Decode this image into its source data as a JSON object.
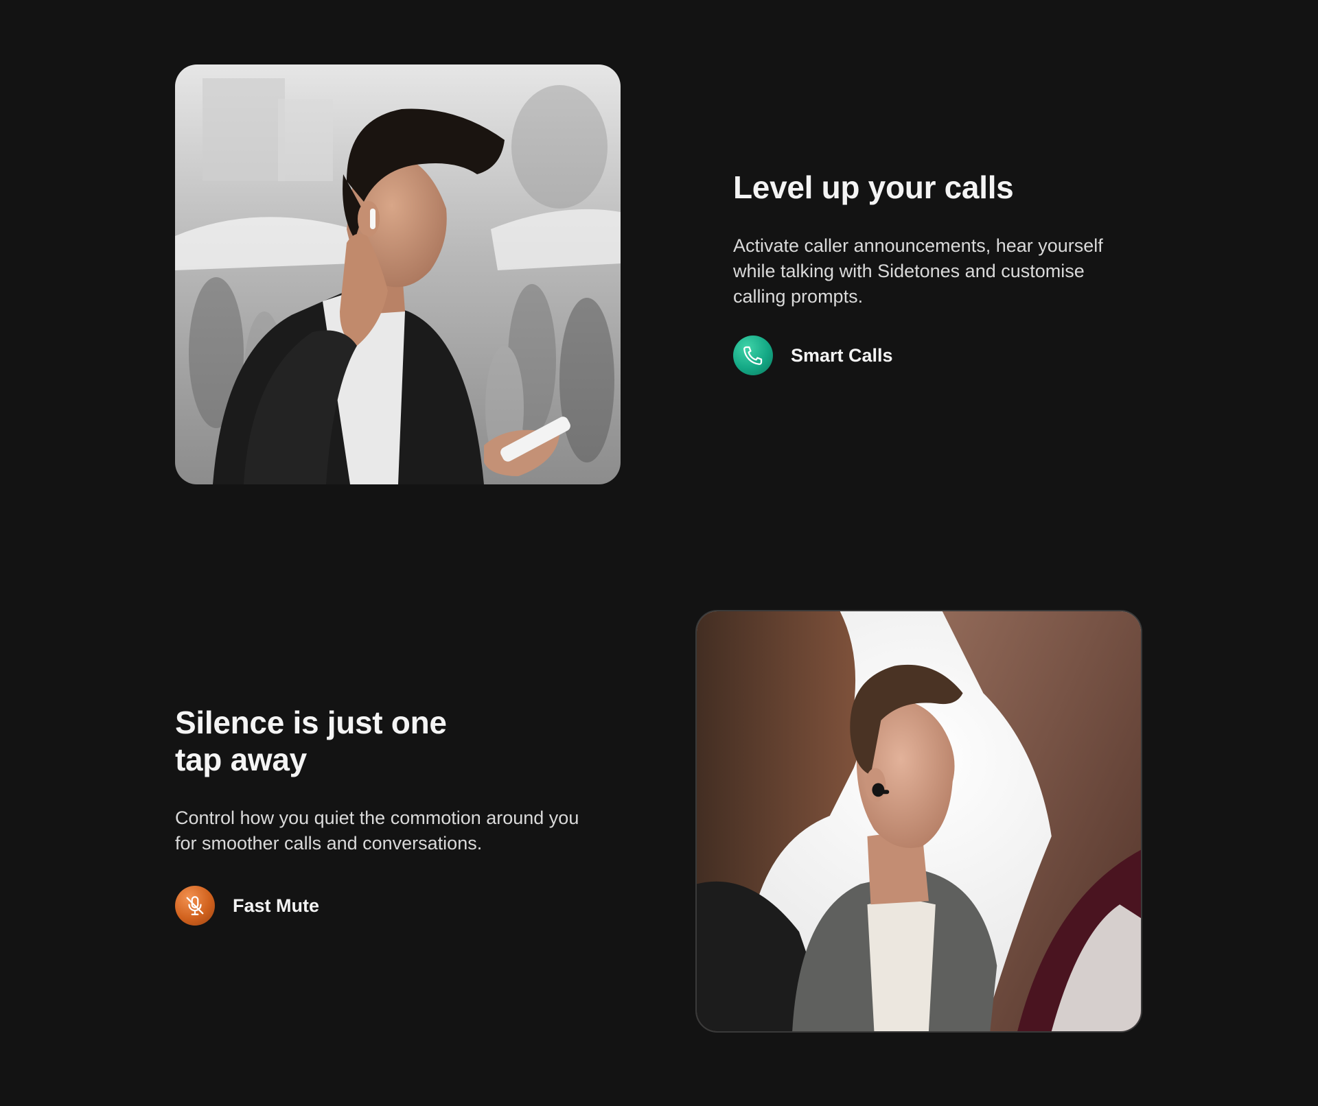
{
  "sections": [
    {
      "heading_lines": [
        "Level up your calls"
      ],
      "description": "Activate caller announcements, hear yourself while talking with Sidetones and customise calling prompts.",
      "feature": {
        "label": "Smart Calls",
        "icon": "phone-icon",
        "color": "#14a885"
      }
    },
    {
      "heading_lines": [
        "Silence is just one",
        "tap away"
      ],
      "description": "Control how you quiet the commotion around you for smoother calls and conversations.",
      "feature": {
        "label": "Fast Mute",
        "icon": "mic-mute-icon",
        "color": "#d1621e"
      }
    }
  ],
  "colors": {
    "background": "#131313",
    "text": "#f4f4f4",
    "muted_text": "#dadada"
  }
}
